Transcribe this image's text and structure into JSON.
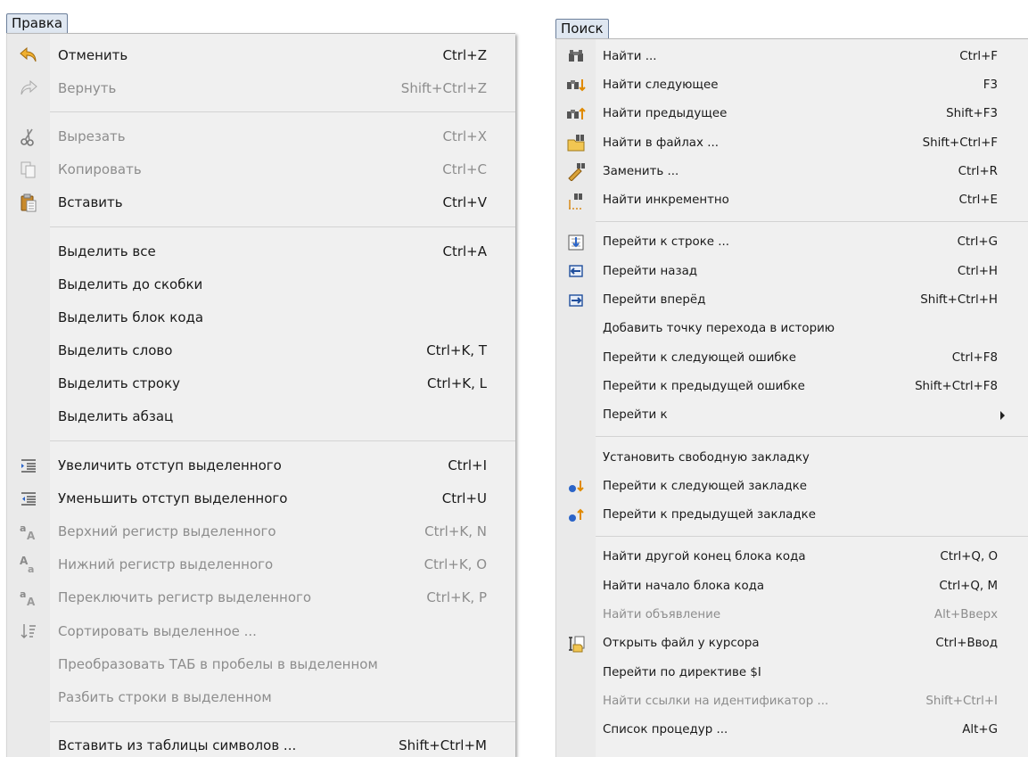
{
  "left_menu": {
    "title": "Правка",
    "groups": [
      [
        {
          "label": "Отменить",
          "shortcut": "Ctrl+Z",
          "icon": "undo-arrow-icon",
          "enabled": true
        },
        {
          "label": "Вернуть",
          "shortcut": "Shift+Ctrl+Z",
          "icon": "redo-arrow-icon",
          "enabled": false
        }
      ],
      [
        {
          "label": "Вырезать",
          "shortcut": "Ctrl+X",
          "icon": "scissors-icon",
          "enabled": false
        },
        {
          "label": "Копировать",
          "shortcut": "Ctrl+C",
          "icon": "copy-pages-icon",
          "enabled": false
        },
        {
          "label": "Вставить",
          "shortcut": "Ctrl+V",
          "icon": "clipboard-paste-icon",
          "enabled": true
        }
      ],
      [
        {
          "label": "Выделить все",
          "shortcut": "Ctrl+A",
          "icon": "",
          "enabled": true
        },
        {
          "label": "Выделить до скобки",
          "shortcut": "",
          "icon": "",
          "enabled": true
        },
        {
          "label": "Выделить блок кода",
          "shortcut": "",
          "icon": "",
          "enabled": true
        },
        {
          "label": "Выделить слово",
          "shortcut": "Ctrl+K, T",
          "icon": "",
          "enabled": true
        },
        {
          "label": "Выделить строку",
          "shortcut": "Ctrl+K, L",
          "icon": "",
          "enabled": true
        },
        {
          "label": "Выделить абзац",
          "shortcut": "",
          "icon": "",
          "enabled": true
        }
      ],
      [
        {
          "label": "Увеличить отступ выделенного",
          "shortcut": "Ctrl+I",
          "icon": "indent-increase-icon",
          "enabled": true
        },
        {
          "label": "Уменьшить отступ выделенного",
          "shortcut": "Ctrl+U",
          "icon": "indent-decrease-icon",
          "enabled": true
        },
        {
          "label": "Верхний регистр выделенного",
          "shortcut": "Ctrl+K, N",
          "icon": "uppercase-icon",
          "enabled": false
        },
        {
          "label": "Нижний регистр выделенного",
          "shortcut": "Ctrl+K, O",
          "icon": "lowercase-icon",
          "enabled": false
        },
        {
          "label": "Переключить регистр выделенного",
          "shortcut": "Ctrl+K, P",
          "icon": "toggle-case-icon",
          "enabled": false
        },
        {
          "label": "Сортировать выделенное ...",
          "shortcut": "",
          "icon": "sort-icon",
          "enabled": false
        },
        {
          "label": "Преобразовать ТАБ в пробелы в выделенном",
          "shortcut": "",
          "icon": "",
          "enabled": false
        },
        {
          "label": "Разбить строки в выделенном",
          "shortcut": "",
          "icon": "",
          "enabled": false
        }
      ],
      [
        {
          "label": "Вставить из таблицы символов ...",
          "shortcut": "Shift+Ctrl+M",
          "icon": "",
          "enabled": true
        }
      ]
    ]
  },
  "right_menu": {
    "title": "Поиск",
    "groups": [
      [
        {
          "label": "Найти ...",
          "shortcut": "Ctrl+F",
          "icon": "binoculars-icon",
          "enabled": true
        },
        {
          "label": "Найти следующее",
          "shortcut": "F3",
          "icon": "find-next-icon",
          "enabled": true
        },
        {
          "label": "Найти предыдущее",
          "shortcut": "Shift+F3",
          "icon": "find-previous-icon",
          "enabled": true
        },
        {
          "label": "Найти в файлах ...",
          "shortcut": "Shift+Ctrl+F",
          "icon": "find-in-files-icon",
          "enabled": true
        },
        {
          "label": "Заменить ...",
          "shortcut": "Ctrl+R",
          "icon": "replace-icon",
          "enabled": true
        },
        {
          "label": "Найти инкрементно",
          "shortcut": "Ctrl+E",
          "icon": "incremental-find-icon",
          "enabled": true
        }
      ],
      [
        {
          "label": "Перейти к строке ...",
          "shortcut": "Ctrl+G",
          "icon": "goto-line-icon",
          "enabled": true
        },
        {
          "label": "Перейти назад",
          "shortcut": "Ctrl+H",
          "icon": "jump-back-icon",
          "enabled": true
        },
        {
          "label": "Перейти вперёд",
          "shortcut": "Shift+Ctrl+H",
          "icon": "jump-forward-icon",
          "enabled": true
        },
        {
          "label": "Добавить точку перехода в историю",
          "shortcut": "",
          "icon": "",
          "enabled": true
        },
        {
          "label": "Перейти к следующей ошибке",
          "shortcut": "Ctrl+F8",
          "icon": "",
          "enabled": true
        },
        {
          "label": "Перейти к предыдущей ошибке",
          "shortcut": "Shift+Ctrl+F8",
          "icon": "",
          "enabled": true
        },
        {
          "label": "Перейти к",
          "shortcut": "",
          "icon": "",
          "enabled": true,
          "submenu": true
        }
      ],
      [
        {
          "label": "Установить свободную закладку",
          "shortcut": "",
          "icon": "",
          "enabled": true
        },
        {
          "label": "Перейти к следующей закладке",
          "shortcut": "",
          "icon": "next-bookmark-icon",
          "enabled": true
        },
        {
          "label": "Перейти к предыдущей закладке",
          "shortcut": "",
          "icon": "previous-bookmark-icon",
          "enabled": true
        }
      ],
      [
        {
          "label": "Найти другой конец блока кода",
          "shortcut": "Ctrl+Q, O",
          "icon": "",
          "enabled": true
        },
        {
          "label": "Найти начало блока кода",
          "shortcut": "Ctrl+Q, M",
          "icon": "",
          "enabled": true
        },
        {
          "label": "Найти объявление",
          "shortcut": "Alt+Вверх",
          "icon": "",
          "enabled": false
        },
        {
          "label": "Открыть файл у курсора",
          "shortcut": "Ctrl+Ввод",
          "icon": "open-file-at-cursor-icon",
          "enabled": true
        },
        {
          "label": "Перейти по директиве $I",
          "shortcut": "",
          "icon": "",
          "enabled": true
        },
        {
          "label": "Найти ссылки на идентификатор ...",
          "shortcut": "Shift+Ctrl+I",
          "icon": "",
          "enabled": false
        },
        {
          "label": "Список процедур ...",
          "shortcut": "Alt+G",
          "icon": "",
          "enabled": true
        }
      ]
    ]
  }
}
